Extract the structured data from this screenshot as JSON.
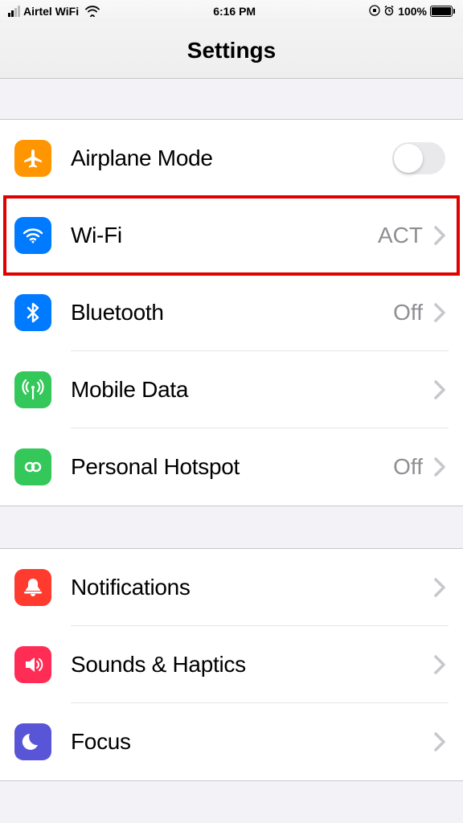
{
  "statusbar": {
    "carrier": "Airtel WiFi",
    "time": "6:16 PM",
    "battery_pct": "100%"
  },
  "nav": {
    "title": "Settings"
  },
  "section1": [
    {
      "id": "airplane",
      "label": "Airplane Mode",
      "value": "",
      "toggle": true,
      "toggle_on": false,
      "chevron": false,
      "highlight": false
    },
    {
      "id": "wifi",
      "label": "Wi-Fi",
      "value": "ACT",
      "toggle": false,
      "chevron": true,
      "highlight": true
    },
    {
      "id": "bluetooth",
      "label": "Bluetooth",
      "value": "Off",
      "toggle": false,
      "chevron": true,
      "highlight": false
    },
    {
      "id": "mobiledata",
      "label": "Mobile Data",
      "value": "",
      "toggle": false,
      "chevron": true,
      "highlight": false
    },
    {
      "id": "hotspot",
      "label": "Personal Hotspot",
      "value": "Off",
      "toggle": false,
      "chevron": true,
      "highlight": false
    }
  ],
  "section2": [
    {
      "id": "notifications",
      "label": "Notifications",
      "value": "",
      "chevron": true
    },
    {
      "id": "sounds",
      "label": "Sounds & Haptics",
      "value": "",
      "chevron": true
    },
    {
      "id": "focus",
      "label": "Focus",
      "value": "",
      "chevron": true
    }
  ]
}
